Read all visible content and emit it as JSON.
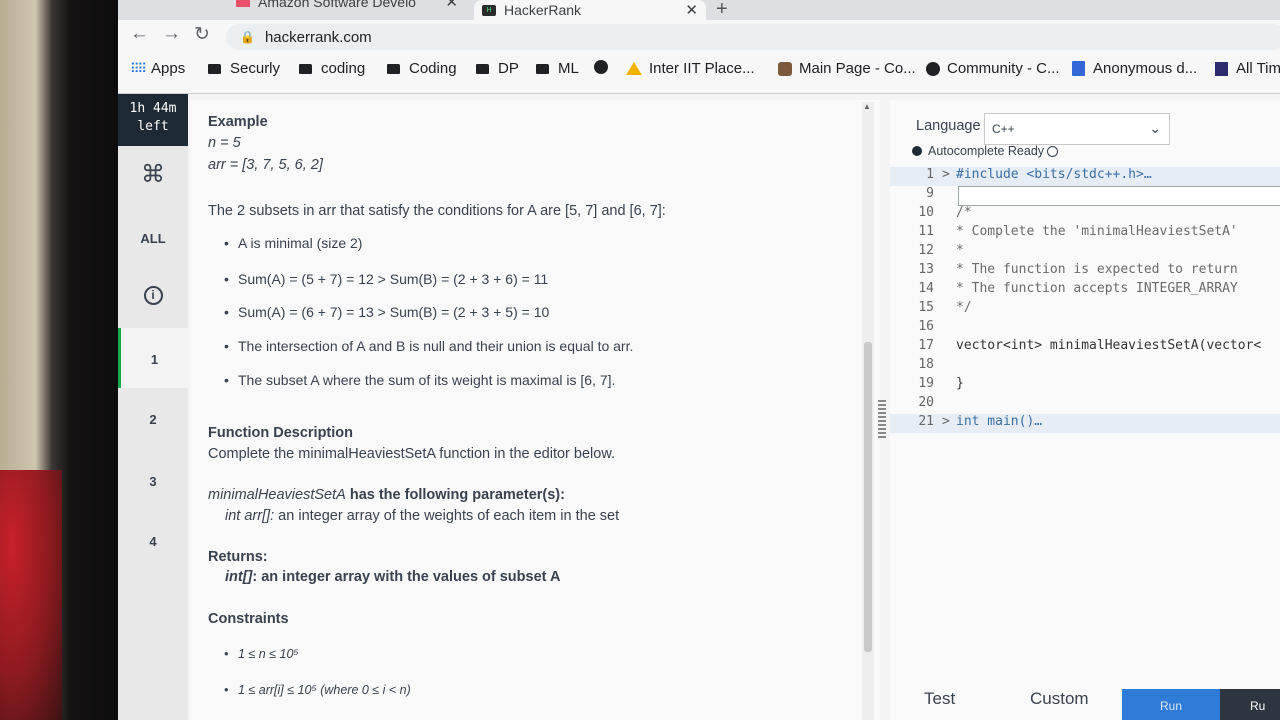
{
  "browser": {
    "tabs": [
      {
        "label": "Amazon Software Develo"
      },
      {
        "label": "HackerRank"
      }
    ],
    "url": "hackerrank.com",
    "bookmarks": [
      "Apps",
      "Securly",
      "coding",
      "Coding",
      "DP",
      "ML",
      "Inter IIT Place...",
      "Main Page - Co...",
      "Community - C...",
      "Anonymous d...",
      "All Tim"
    ]
  },
  "rail": {
    "timer_line1": "1h 44m",
    "timer_line2": "left",
    "cmd_symbol": "⌘",
    "all_label": "ALL",
    "info_symbol": "i",
    "questions": [
      "1",
      "2",
      "3",
      "4"
    ]
  },
  "problem": {
    "example_heading": "Example",
    "n_line": "n = 5",
    "arr_line": "arr = [3, 7, 5, 6, 2]",
    "subsets_text": "The 2 subsets in arr that satisfy the conditions for A are [5, 7] and [6, 7]:",
    "bullets": [
      "A is minimal (size 2)",
      "Sum(A) = (5 + 7) = 12 > Sum(B) = (2 + 3 + 6) = 11",
      "Sum(A) = (6 + 7) = 13 > Sum(B) = (2 + 3 + 5) = 10",
      "The intersection of A and B is null and their union is equal to arr.",
      "The subset A where the sum of its weight is maximal is [6, 7]."
    ],
    "func_desc_heading": "Function Description",
    "func_desc_text": "Complete the minimalHeaviestSetA function in the editor below.",
    "params_heading_fn": "minimalHeaviestSetA",
    "params_heading_rest": " has the following parameter(s):",
    "param_type": "int arr[]:",
    "param_desc": " an integer array of the weights of each item in the set",
    "returns_heading": "Returns:",
    "returns_type": "int[]",
    "returns_desc": ": an integer array with the values of subset A",
    "constraints_heading": "Constraints",
    "constraint1": "1 ≤ n ≤ 10⁵",
    "constraint2": "1 ≤ arr[i] ≤ 10⁵ (where 0 ≤ i < n)"
  },
  "editor": {
    "language_label": "Language",
    "language_value": "C++",
    "autocomplete": "Autocomplete Ready",
    "lines": [
      {
        "n": "1",
        "fold": ">",
        "text": "#include <bits/stdc++.h>…"
      },
      {
        "n": "9",
        "fold": "",
        "text": ""
      },
      {
        "n": "10",
        "fold": "",
        "text": "/*"
      },
      {
        "n": "11",
        "fold": "",
        "text": " * Complete the 'minimalHeaviestSetA'"
      },
      {
        "n": "12",
        "fold": "",
        "text": " *"
      },
      {
        "n": "13",
        "fold": "",
        "text": " * The function is expected to return"
      },
      {
        "n": "14",
        "fold": "",
        "text": " * The function accepts INTEGER_ARRAY"
      },
      {
        "n": "15",
        "fold": "",
        "text": " */"
      },
      {
        "n": "16",
        "fold": "",
        "text": ""
      },
      {
        "n": "17",
        "fold": "",
        "text": "vector<int> minimalHeaviestSetA(vector<"
      },
      {
        "n": "18",
        "fold": "",
        "text": ""
      },
      {
        "n": "19",
        "fold": "",
        "text": "}"
      },
      {
        "n": "20",
        "fold": "",
        "text": ""
      },
      {
        "n": "21",
        "fold": ">",
        "text": "int main()…"
      }
    ],
    "test_tab": "Test",
    "custom_tab": "Custom",
    "run_button": "Run",
    "run_all_button": "Ru"
  }
}
